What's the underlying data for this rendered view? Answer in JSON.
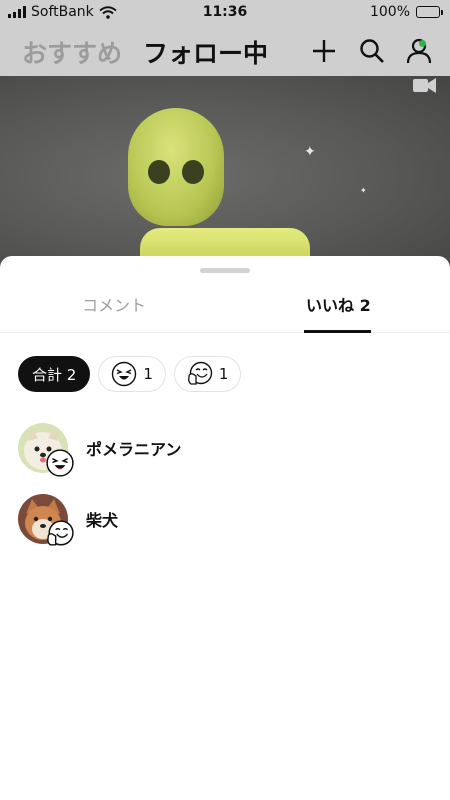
{
  "status_bar": {
    "carrier": "SoftBank",
    "time": "11:36",
    "battery": "100%"
  },
  "header": {
    "tab_recommended": "おすすめ",
    "tab_following": "フォロー中"
  },
  "sheet": {
    "tabs": {
      "comments": "コメント",
      "likes": "いいね 2"
    },
    "filters": {
      "total": "合計 2",
      "reaction_a_count": "1",
      "reaction_b_count": "1"
    },
    "users": [
      {
        "name": "ポメラニアン",
        "reaction": "laughing-face-icon"
      },
      {
        "name": "柴犬",
        "reaction": "thumbs-up-face-icon"
      }
    ]
  },
  "colors": {
    "online_dot": "#2fb34b",
    "battery": "#3fb64a"
  }
}
